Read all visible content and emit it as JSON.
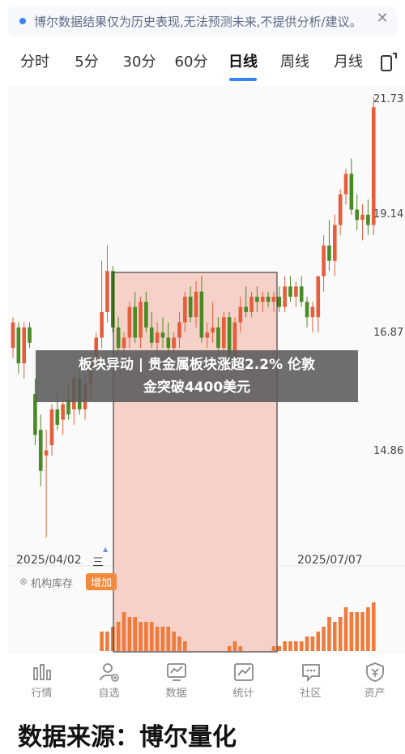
{
  "banner": {
    "text": "博尔数据结果仅为历史表现,无法预测未来,不提供分析/建议。",
    "close_symbol": "✕",
    "dot_color": "#3b82f6"
  },
  "period_tabs": {
    "items": [
      "分时",
      "5分",
      "30分",
      "60分",
      "日线",
      "周线",
      "月线"
    ],
    "active": "日线",
    "accent_color": "#3b82f6"
  },
  "chart": {
    "price_labels": [
      "21.73",
      "19.14",
      "16.87",
      "14.86"
    ],
    "date_labels": [
      "2025/04/02",
      "2025/07/07"
    ],
    "date_icon_symbol": "三",
    "holding_icon": "⊗",
    "holding_label": "机构库存",
    "increase_badge": "增加",
    "up_color": "#e55e3c",
    "down_color": "#4a8a24",
    "highlight_color": "#f4c9c0"
  },
  "chart_data": {
    "type": "candlestick",
    "y_axis_ticks": [
      "21.73",
      "19.14",
      "16.87",
      "14.86"
    ],
    "x_axis_ticks": [
      "2025/04/02",
      "2025/07/07"
    ],
    "ohlc": [
      [
        16.9,
        17.5,
        16.7,
        17.4
      ],
      [
        17.3,
        17.4,
        16.4,
        16.6
      ],
      [
        16.6,
        17.4,
        16.3,
        17.3
      ],
      [
        17.3,
        17.4,
        16.9,
        17.0
      ],
      [
        16.0,
        16.3,
        15.0,
        15.2
      ],
      [
        15.3,
        15.6,
        14.2,
        14.5
      ],
      [
        14.8,
        15.3,
        13.2,
        14.9
      ],
      [
        15.0,
        15.8,
        14.8,
        15.7
      ],
      [
        15.7,
        16.0,
        15.3,
        15.4
      ],
      [
        15.5,
        15.9,
        15.2,
        15.8
      ],
      [
        15.9,
        16.2,
        15.5,
        15.6
      ],
      [
        15.7,
        16.4,
        15.4,
        16.3
      ],
      [
        16.3,
        16.5,
        15.6,
        15.7
      ],
      [
        15.7,
        16.4,
        15.5,
        16.2
      ],
      [
        16.2,
        16.8,
        15.9,
        16.7
      ],
      [
        16.7,
        17.2,
        16.5,
        17.1
      ],
      [
        17.1,
        18.6,
        16.9,
        17.6
      ],
      [
        17.6,
        18.9,
        17.4,
        18.4
      ],
      [
        18.4,
        18.5,
        17.2,
        17.3
      ],
      [
        17.3,
        17.5,
        16.8,
        16.9
      ],
      [
        16.9,
        17.2,
        16.6,
        17.1
      ],
      [
        17.1,
        17.8,
        16.9,
        17.7
      ],
      [
        17.7,
        18.0,
        17.0,
        17.1
      ],
      [
        17.1,
        17.9,
        16.9,
        17.8
      ],
      [
        17.8,
        18.0,
        17.2,
        17.3
      ],
      [
        17.3,
        17.6,
        16.9,
        17.0
      ],
      [
        17.0,
        17.4,
        16.8,
        17.2
      ],
      [
        17.2,
        17.5,
        16.9,
        17.1
      ],
      [
        17.1,
        17.4,
        16.7,
        16.9
      ],
      [
        16.9,
        17.2,
        16.8,
        17.1
      ],
      [
        17.1,
        17.6,
        16.9,
        17.4
      ],
      [
        17.4,
        18.0,
        17.2,
        17.9
      ],
      [
        17.9,
        18.1,
        17.4,
        17.5
      ],
      [
        17.5,
        18.2,
        17.3,
        18.0
      ],
      [
        18.0,
        18.3,
        17.0,
        17.1
      ],
      [
        17.1,
        17.4,
        16.9,
        17.2
      ],
      [
        17.2,
        17.8,
        17.0,
        17.3
      ],
      [
        17.3,
        17.5,
        16.7,
        16.9
      ],
      [
        16.9,
        17.6,
        16.8,
        17.5
      ],
      [
        17.5,
        17.6,
        16.6,
        16.7
      ],
      [
        16.7,
        17.5,
        16.5,
        17.4
      ],
      [
        17.4,
        17.9,
        17.2,
        17.7
      ],
      [
        17.7,
        18.1,
        17.5,
        17.6
      ],
      [
        17.6,
        18.0,
        17.5,
        17.9
      ],
      [
        17.9,
        18.1,
        17.6,
        17.8
      ],
      [
        17.8,
        18.0,
        17.6,
        17.9
      ],
      [
        17.9,
        18.0,
        17.7,
        17.8
      ],
      [
        17.8,
        18.0,
        17.6,
        17.9
      ],
      [
        17.9,
        18.1,
        17.6,
        17.7
      ],
      [
        17.7,
        18.3,
        17.6,
        18.1
      ],
      [
        18.1,
        18.3,
        17.8,
        17.9
      ],
      [
        17.9,
        18.2,
        17.7,
        18.1
      ],
      [
        18.1,
        18.3,
        17.7,
        17.8
      ],
      [
        17.8,
        17.9,
        17.3,
        17.5
      ],
      [
        17.5,
        17.8,
        17.2,
        17.7
      ],
      [
        17.5,
        18.3,
        17.2,
        18.3
      ],
      [
        18.3,
        19.1,
        18.0,
        18.9
      ],
      [
        18.9,
        19.4,
        18.4,
        18.6
      ],
      [
        18.6,
        19.5,
        18.3,
        19.3
      ],
      [
        19.3,
        20.0,
        19.1,
        19.9
      ],
      [
        19.9,
        20.4,
        19.7,
        20.3
      ],
      [
        20.3,
        20.6,
        19.5,
        19.6
      ],
      [
        19.6,
        19.9,
        19.2,
        19.4
      ],
      [
        19.4,
        19.7,
        19.0,
        19.5
      ],
      [
        19.5,
        19.8,
        19.1,
        19.3
      ],
      [
        19.3,
        21.8,
        19.1,
        21.6
      ]
    ],
    "volume": [
      0,
      0,
      0,
      0,
      0,
      0,
      0,
      0,
      0,
      0,
      0,
      0,
      0,
      0,
      0,
      0,
      4,
      4,
      5,
      6,
      8,
      7,
      7,
      6,
      6,
      6,
      5,
      5,
      5,
      4,
      3,
      2,
      0,
      0,
      0,
      0,
      0,
      0,
      0,
      1,
      2,
      1,
      0,
      0,
      0,
      0,
      0,
      1,
      1,
      2,
      2,
      2,
      2,
      3,
      3,
      4,
      5,
      7,
      6,
      7,
      9,
      8,
      8,
      8,
      9,
      10
    ]
  },
  "headline": {
    "line1": "板块异动 | 贵金属板块涨超2.2% 伦敦",
    "line2": "金突破4400美元"
  },
  "bottom_nav": {
    "items": [
      {
        "label": "行情",
        "icon": "market-icon"
      },
      {
        "label": "自选",
        "icon": "watchlist-icon"
      },
      {
        "label": "数据",
        "icon": "data-icon"
      },
      {
        "label": "统计",
        "icon": "statistics-icon"
      },
      {
        "label": "社区",
        "icon": "community-icon"
      },
      {
        "label": "资产",
        "icon": "assets-icon"
      }
    ]
  },
  "source": {
    "text": "数据来源：博尔量化"
  }
}
